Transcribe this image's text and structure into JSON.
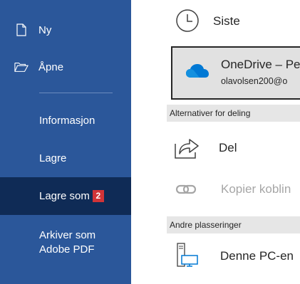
{
  "sidebar": {
    "new_label": "Ny",
    "open_label": "Åpne",
    "info_label": "Informasjon",
    "save_label": "Lagre",
    "save_as_label": "Lagre som",
    "save_as_badge": "2",
    "archive_line1": "Arkiver som",
    "archive_line2": "Adobe PDF"
  },
  "main": {
    "recent_label": "Siste",
    "onedrive_title": "OneDrive – Pe",
    "onedrive_email": "olavolsen200@o",
    "share_header": "Alternativer for deling",
    "share_label": "Del",
    "copy_link_label": "Kopier koblin",
    "other_places_header": "Andre plasseringer",
    "this_pc_label": "Denne PC-en"
  },
  "colors": {
    "sidebar_bg": "#2b579a",
    "selected_bg": "#0f2b56",
    "badge_bg": "#d13438",
    "onedrive_blue": "#0078d4"
  }
}
